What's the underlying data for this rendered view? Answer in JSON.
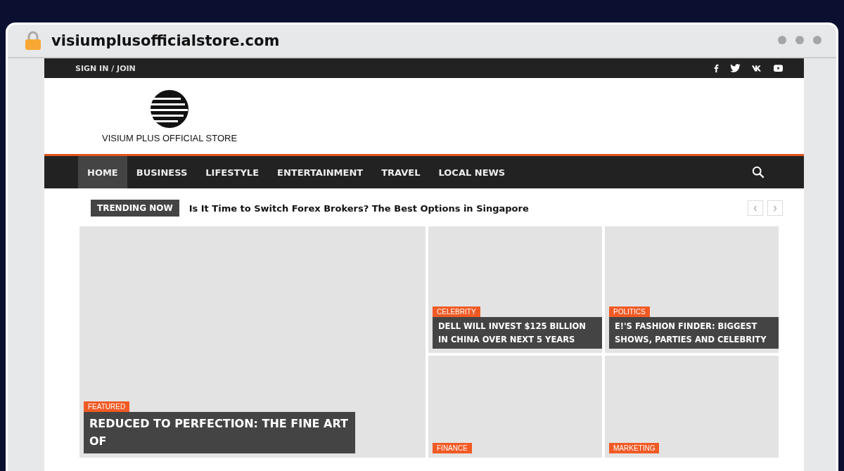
{
  "browser": {
    "url": "visiumplusofficialstore.com"
  },
  "top_bar": {
    "sign_in": "SIGN IN / JOIN"
  },
  "logo": {
    "text": "VISIUM PLUS OFFICIAL STORE"
  },
  "nav": {
    "items": [
      {
        "label": "HOME",
        "selected": true
      },
      {
        "label": "BUSINESS",
        "selected": false
      },
      {
        "label": "LIFESTYLE",
        "selected": false
      },
      {
        "label": "ENTERTAINMENT",
        "selected": false
      },
      {
        "label": "TRAVEL",
        "selected": false
      },
      {
        "label": "LOCAL NEWS",
        "selected": false
      }
    ]
  },
  "trending": {
    "label": "TRENDING NOW",
    "headline": "Is It Time to Switch Forex Brokers? The Best Options in Singapore"
  },
  "posts": [
    {
      "category": "FEATURED",
      "title": "REDUCED TO PERFECTION: THE FINE ART OF"
    },
    {
      "category": "CELEBRITY",
      "title": "DELL WILL INVEST $125 BILLION IN CHINA OVER NEXT 5 YEARS"
    },
    {
      "category": "POLITICS",
      "title": "E!'S FASHION FINDER: BIGGEST SHOWS, PARTIES AND CELEBRITY"
    },
    {
      "category": "FINANCE"
    },
    {
      "category": "MARKETING"
    }
  ]
}
